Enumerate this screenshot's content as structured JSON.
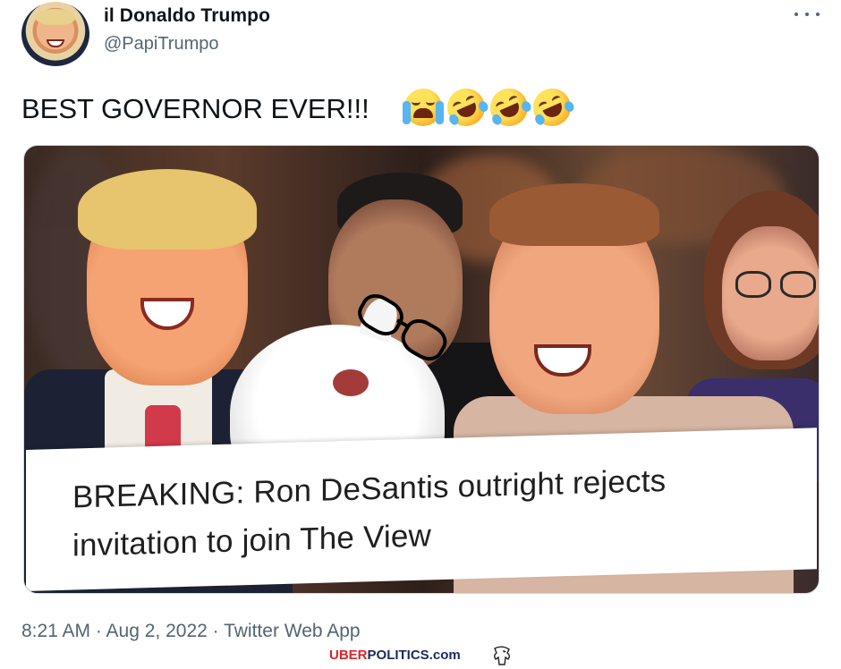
{
  "author": {
    "display_name": "il Donaldo Trumpo",
    "handle": "@PapiTrumpo"
  },
  "tweet": {
    "text": "BEST GOVERNOR EVER!!!",
    "emojis": [
      "loudly-crying-face",
      "rolling-on-floor-laughing",
      "rolling-on-floor-laughing",
      "rolling-on-floor-laughing"
    ]
  },
  "media": {
    "headline": "BREAKING: Ron DeSantis outright rejects invitation to join The View"
  },
  "meta": {
    "timestamp": "8:21 AM · Aug 2, 2022 · Twitter Web App"
  },
  "watermark": {
    "brand_part1": "UBER",
    "brand_part2": "POLITICS.com",
    "icon": "eagle-icon"
  },
  "colors": {
    "text_primary": "#0f1419",
    "text_secondary": "#536471",
    "brand_red": "#d7262c",
    "brand_navy": "#1b2a5e"
  }
}
